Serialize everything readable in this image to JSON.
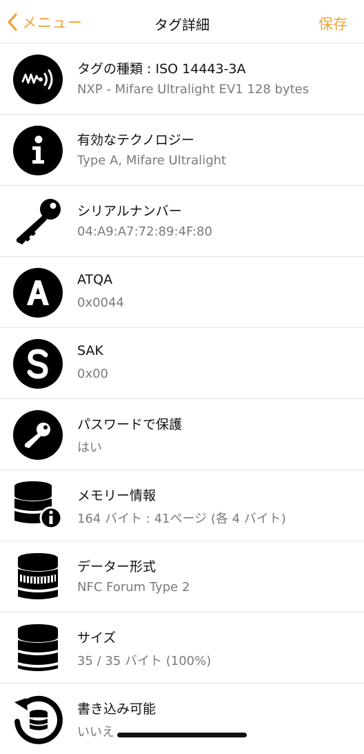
{
  "nav": {
    "back_label": "メニュー",
    "title": "タグ詳細",
    "save_label": "保存",
    "accent": "#f0a33a"
  },
  "rows": [
    {
      "icon": "nfc-wave-icon",
      "title": "タグの種類 : ISO 14443-3A",
      "value": "NXP - Mifare Ultralight EV1 128 bytes"
    },
    {
      "icon": "info-icon",
      "title": "有効なテクノロジー",
      "value": "Type A, Mifare Ultralight"
    },
    {
      "icon": "key-icon",
      "title": "シリアルナンバー",
      "value": "04:A9:A7:72:89:4F:80"
    },
    {
      "icon": "letter-a-icon",
      "title": "ATQA",
      "value": "0x0044"
    },
    {
      "icon": "letter-s-icon",
      "title": "SAK",
      "value": "0x00"
    },
    {
      "icon": "password-key-icon",
      "title": "パスワードで保護",
      "value": "はい"
    },
    {
      "icon": "database-info-icon",
      "title": "メモリー情報",
      "value": "164 バイト : 41ページ (各 4 バイト)"
    },
    {
      "icon": "database-ring-icon",
      "title": "データー形式",
      "value": "NFC Forum Type 2"
    },
    {
      "icon": "database-icon",
      "title": "サイズ",
      "value": "35 / 35 バイト (100%)"
    },
    {
      "icon": "database-refresh-icon",
      "title": "書き込み可能",
      "value": "いいえ"
    }
  ]
}
